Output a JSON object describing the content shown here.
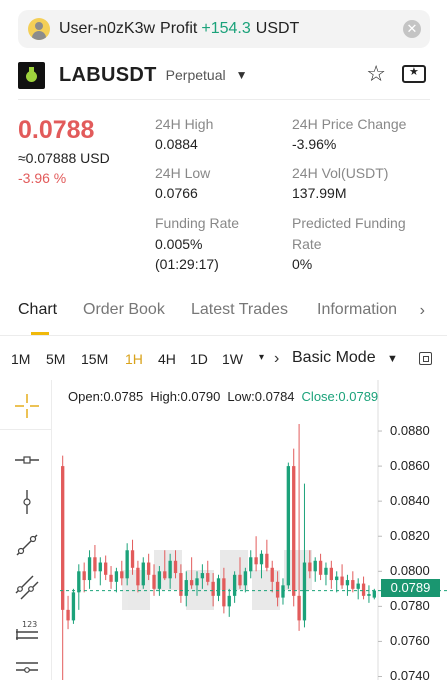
{
  "banner": {
    "user": "User-n0zK3w",
    "profit_label": "Profit",
    "profit_value": "+154.3",
    "profit_unit": "USDT"
  },
  "header": {
    "pair": "LABUSDT",
    "contract_type": "Perpetual"
  },
  "price": {
    "last": "0.0788",
    "usd": "≈0.07888 USD",
    "change_pct": "-3.96 %"
  },
  "stats": {
    "high_label": "24H High",
    "high": "0.0884",
    "change_label": "24H Price Change",
    "change": "-3.96%",
    "low_label": "24H Low",
    "low": "0.0766",
    "vol_label": "24H Vol(USDT)",
    "vol": "137.99M",
    "funding_label": "Funding Rate",
    "funding": "0.005%",
    "funding_countdown": "(01:29:17)",
    "pred_label_1": "Predicted Funding",
    "pred_label_2": "Rate",
    "pred": "0%"
  },
  "tabs": [
    "Chart",
    "Order Book",
    "Latest Trades",
    "Information"
  ],
  "timeframes": [
    "1M",
    "5M",
    "15M",
    "1H",
    "4H",
    "1D",
    "1W"
  ],
  "active_timeframe": "1H",
  "mode": "Basic Mode",
  "ohlc": {
    "open": "Open:0.0785",
    "high": "High:0.0790",
    "low": "Low:0.0784",
    "close": "Close:0.0789"
  },
  "last_price_tag": "0.0789",
  "colors": {
    "up": "#1ba27a",
    "down": "#e25b5b",
    "accent": "#f0b90b"
  },
  "chart_data": {
    "type": "candlestick",
    "y_ticks": [
      "0.0880",
      "0.0860",
      "0.0840",
      "0.0820",
      "0.0800",
      "0.0780",
      "0.0760",
      "0.0740"
    ],
    "ylim": [
      0.0738,
      0.0892
    ],
    "last_price": 0.0789,
    "candles": [
      [
        0.086,
        0.0866,
        0.0738,
        0.0778
      ],
      [
        0.0778,
        0.0786,
        0.0767,
        0.0772
      ],
      [
        0.0772,
        0.079,
        0.077,
        0.0788
      ],
      [
        0.0788,
        0.0804,
        0.0778,
        0.08
      ],
      [
        0.08,
        0.0805,
        0.0788,
        0.0795
      ],
      [
        0.0795,
        0.0812,
        0.079,
        0.0808
      ],
      [
        0.0808,
        0.0815,
        0.0796,
        0.08
      ],
      [
        0.08,
        0.0808,
        0.0792,
        0.0805
      ],
      [
        0.0805,
        0.0809,
        0.0795,
        0.0798
      ],
      [
        0.0798,
        0.0803,
        0.079,
        0.0794
      ],
      [
        0.0794,
        0.0802,
        0.0788,
        0.08
      ],
      [
        0.08,
        0.0806,
        0.0792,
        0.0796
      ],
      [
        0.0796,
        0.0816,
        0.0792,
        0.0812
      ],
      [
        0.0812,
        0.0818,
        0.0798,
        0.0802
      ],
      [
        0.0802,
        0.0806,
        0.0788,
        0.0792
      ],
      [
        0.0792,
        0.0808,
        0.079,
        0.0805
      ],
      [
        0.0805,
        0.081,
        0.0795,
        0.0798
      ],
      [
        0.0798,
        0.0804,
        0.0786,
        0.079
      ],
      [
        0.079,
        0.0803,
        0.0786,
        0.08
      ],
      [
        0.08,
        0.0812,
        0.0795,
        0.0796
      ],
      [
        0.0796,
        0.081,
        0.079,
        0.0806
      ],
      [
        0.0806,
        0.0812,
        0.0796,
        0.0799
      ],
      [
        0.0799,
        0.0804,
        0.0782,
        0.0786
      ],
      [
        0.0786,
        0.08,
        0.078,
        0.0795
      ],
      [
        0.0795,
        0.0808,
        0.079,
        0.0792
      ],
      [
        0.0792,
        0.08,
        0.0786,
        0.0796
      ],
      [
        0.0796,
        0.0804,
        0.079,
        0.0799
      ],
      [
        0.0799,
        0.0806,
        0.0792,
        0.0794
      ],
      [
        0.0794,
        0.0799,
        0.078,
        0.0786
      ],
      [
        0.0786,
        0.0798,
        0.0783,
        0.0796
      ],
      [
        0.0796,
        0.0802,
        0.0776,
        0.078
      ],
      [
        0.078,
        0.079,
        0.0774,
        0.0786
      ],
      [
        0.0786,
        0.08,
        0.0782,
        0.0798
      ],
      [
        0.0798,
        0.0808,
        0.079,
        0.0792
      ],
      [
        0.0792,
        0.0802,
        0.0788,
        0.08
      ],
      [
        0.08,
        0.0812,
        0.0796,
        0.0808
      ],
      [
        0.0808,
        0.082,
        0.08,
        0.0804
      ],
      [
        0.0804,
        0.0812,
        0.0796,
        0.081
      ],
      [
        0.081,
        0.0818,
        0.08,
        0.0802
      ],
      [
        0.0802,
        0.0806,
        0.0788,
        0.0794
      ],
      [
        0.0794,
        0.08,
        0.078,
        0.0785
      ],
      [
        0.0785,
        0.0796,
        0.0781,
        0.0792
      ],
      [
        0.0792,
        0.0862,
        0.079,
        0.086
      ],
      [
        0.086,
        0.087,
        0.078,
        0.0786
      ],
      [
        0.0786,
        0.0884,
        0.0766,
        0.0772
      ],
      [
        0.0772,
        0.085,
        0.0768,
        0.0805
      ],
      [
        0.0805,
        0.0812,
        0.0796,
        0.08
      ],
      [
        0.08,
        0.0808,
        0.0794,
        0.0806
      ],
      [
        0.0806,
        0.081,
        0.0795,
        0.0798
      ],
      [
        0.0798,
        0.0805,
        0.0792,
        0.0802
      ],
      [
        0.0802,
        0.0806,
        0.079,
        0.0795
      ],
      [
        0.0795,
        0.08,
        0.0788,
        0.0797
      ],
      [
        0.0797,
        0.0804,
        0.079,
        0.0792
      ],
      [
        0.0792,
        0.0798,
        0.0786,
        0.0795
      ],
      [
        0.0795,
        0.08,
        0.0788,
        0.079
      ],
      [
        0.079,
        0.0796,
        0.0784,
        0.0793
      ],
      [
        0.0793,
        0.0797,
        0.0784,
        0.0786
      ],
      [
        0.0786,
        0.0792,
        0.0782,
        0.0787
      ],
      [
        0.0785,
        0.079,
        0.0784,
        0.0789
      ]
    ]
  }
}
